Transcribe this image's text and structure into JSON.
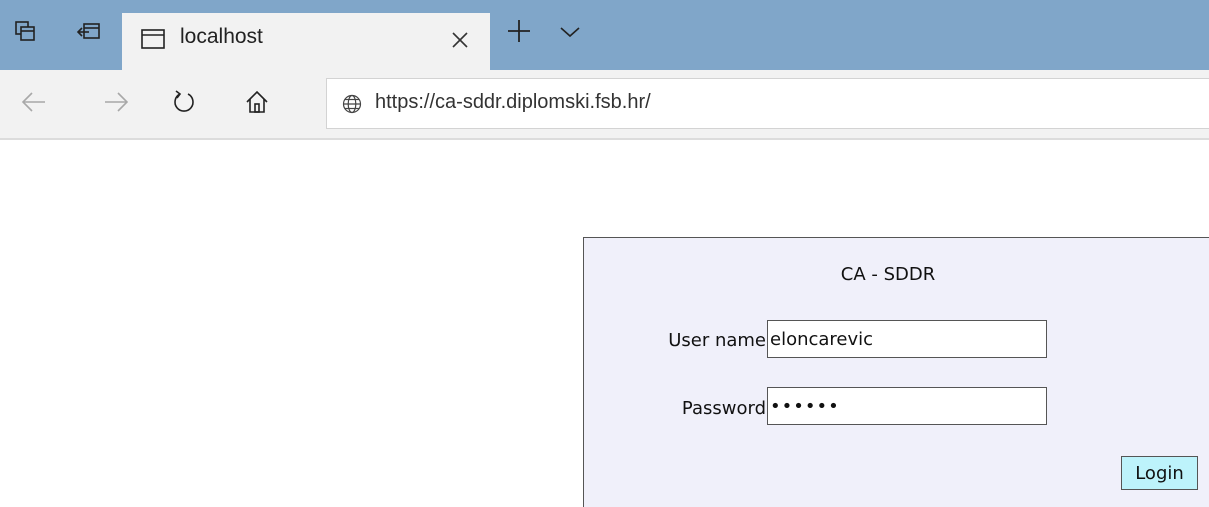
{
  "browser": {
    "tab": {
      "title": "localhost"
    },
    "address": {
      "url": "https://ca-sddr.diplomski.fsb.hr/"
    },
    "icons": {
      "set_aside_tabs": "set-aside-tabs-icon",
      "restore_tabs": "restore-tabs-icon",
      "tab_page": "page-icon",
      "tab_close": "close-icon",
      "new_tab": "plus-icon",
      "tab_menu": "chevron-down-icon",
      "back": "back-arrow-icon",
      "forward": "forward-arrow-icon",
      "refresh": "refresh-icon",
      "home": "home-icon",
      "site": "globe-icon"
    },
    "colors": {
      "tab_strip": "#80a6c9",
      "toolbar": "#f2f2f2"
    }
  },
  "login": {
    "title": "CA - SDDR",
    "username_label": "User name",
    "username_value": "eloncarevic",
    "password_label": "Password",
    "password_value": "••••••",
    "button_label": "Login",
    "colors": {
      "panel": "#f0f0fa",
      "button": "#bdf3fb"
    }
  }
}
